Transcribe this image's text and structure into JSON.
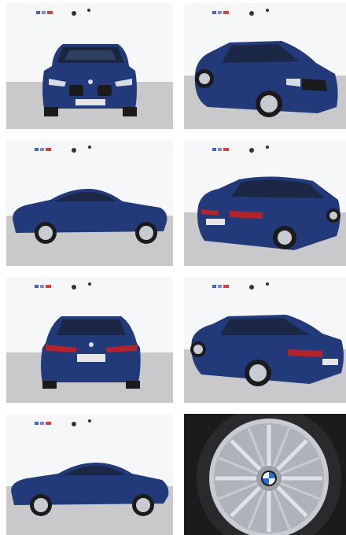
{
  "gallery": {
    "photos": [
      {
        "view": "front"
      },
      {
        "view": "front-three-quarter-right"
      },
      {
        "view": "side-left"
      },
      {
        "view": "rear-three-quarter-right"
      },
      {
        "view": "rear"
      },
      {
        "view": "front-three-quarter-left"
      },
      {
        "view": "side-left-alt"
      },
      {
        "view": "wheel-closeup"
      }
    ],
    "colors": {
      "car_body": "#223a7a",
      "car_highlight": "#3d5aa8",
      "floor": "#c9c9cb",
      "wall": "#f6f7f9",
      "tire": "#1b1b1d",
      "rim": "#c8ccd2",
      "taillight": "#b3232b"
    }
  }
}
